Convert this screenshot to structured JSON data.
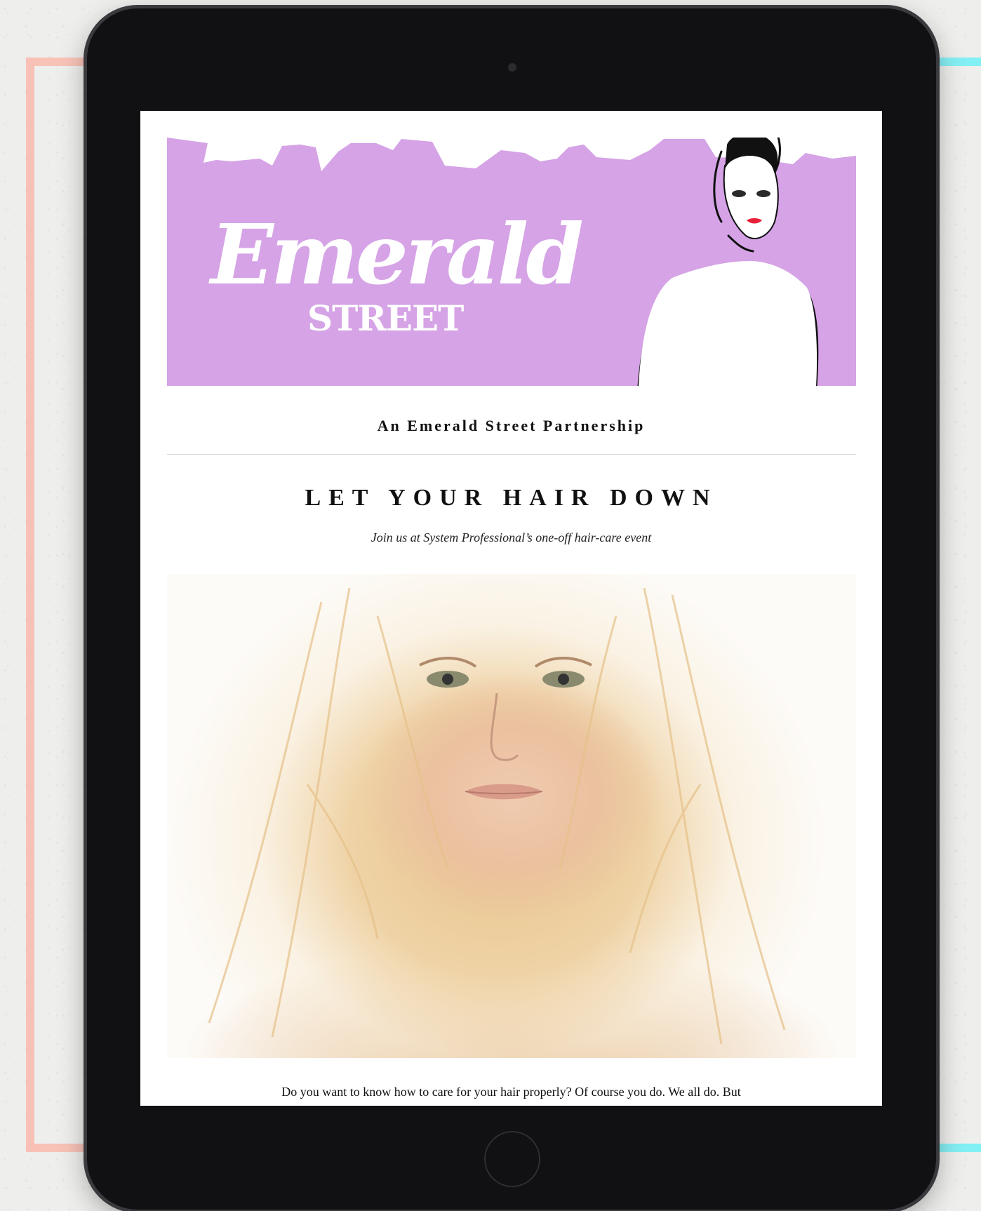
{
  "colors": {
    "banner": "#d5a3e6",
    "frame_left": "#f9c1b6",
    "frame_right": "#7ff0f5",
    "device": "#111114"
  },
  "email": {
    "brand_name": "Emerald",
    "brand_sub": "STREET",
    "partnership": "An Emerald Street Partnership",
    "headline": "LET YOUR HAIR DOWN",
    "subheadline": "Join us at System Professional’s one-off hair-care event",
    "body_first_line": "Do you want to know how to care for your hair properly? Of course you do. We all do. But"
  },
  "icons": {
    "camera": "camera-dot-icon",
    "home": "home-button-icon"
  }
}
